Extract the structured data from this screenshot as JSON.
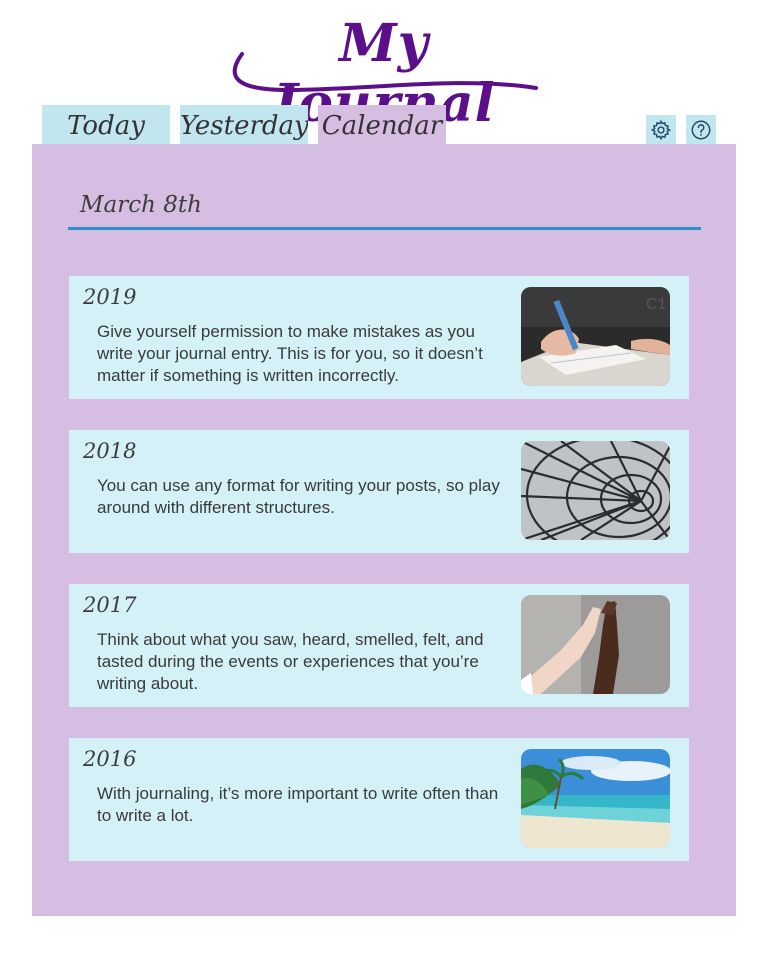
{
  "app": {
    "title": "My Journal"
  },
  "tabs": [
    {
      "label": "Today",
      "active": false
    },
    {
      "label": "Yesterday",
      "active": false
    },
    {
      "label": "Calendar",
      "active": true
    }
  ],
  "toolbar": {
    "settings_icon": "gear-icon",
    "help_icon": "question-icon"
  },
  "colors": {
    "title": "#5b0f8a",
    "tab": "#c1e6ef",
    "panel": "#d6bde2",
    "entry": "#d3f1f7",
    "rule": "#2e8fcf"
  },
  "calendar": {
    "date": "March 8th",
    "entries": [
      {
        "year": "2019",
        "text": "Give yourself permission to make mistakes as you write your journal entry. This is for you, so it doesn’t matter if something is written incorrectly."
      },
      {
        "year": "2018",
        "text": "You can use any format for writing your posts, so play around with different structures."
      },
      {
        "year": "2017",
        "text": "Think about what you saw, heard, smelled, felt, and tasted during the events or experiences that you’re writing about."
      },
      {
        "year": "2016",
        "text": "With journaling, it’s more important to write often than to write a lot."
      }
    ]
  }
}
